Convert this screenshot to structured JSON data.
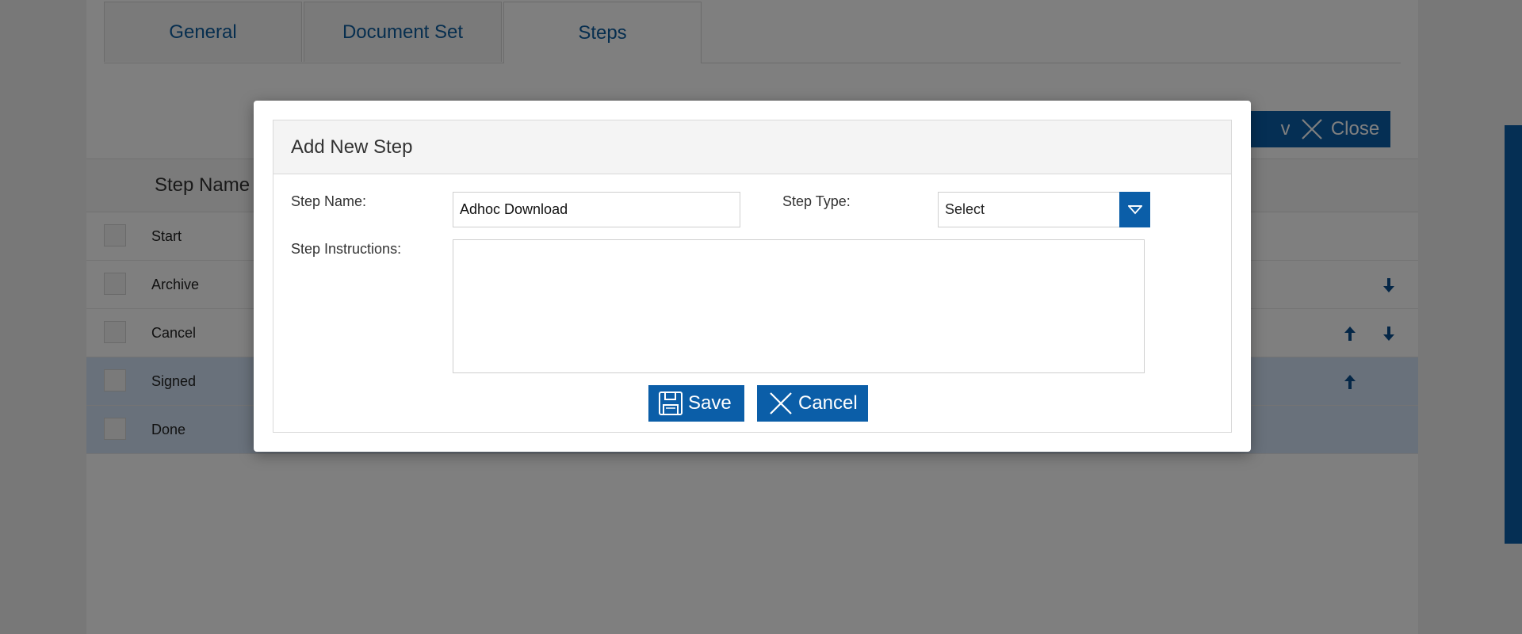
{
  "tabs": [
    {
      "label": "General"
    },
    {
      "label": "Document Set"
    },
    {
      "label": "Steps"
    }
  ],
  "toolbar": {
    "save_label": "ve",
    "close_label": "Close"
  },
  "grid": {
    "column_step_name": "Step Name",
    "rows": [
      {
        "name": "Start"
      },
      {
        "name": "Archive"
      },
      {
        "name": "Cancel"
      },
      {
        "name": "Signed"
      },
      {
        "name": "Done"
      }
    ]
  },
  "modal": {
    "title": "Add New Step",
    "step_name_label": "Step Name:",
    "step_name_value": "Adhoc Download",
    "step_type_label": "Step Type:",
    "step_type_value": "Select",
    "step_instructions_label": "Step Instructions:",
    "step_instructions_value": "",
    "save_label": "Save",
    "cancel_label": "Cancel"
  },
  "colors": {
    "accent": "#0b5ea8",
    "selected_row": "#d2e3f6"
  },
  "icons": [
    "x-icon",
    "arrow-up-icon",
    "arrow-down-icon",
    "floppy-icon",
    "chevron-down-icon"
  ]
}
